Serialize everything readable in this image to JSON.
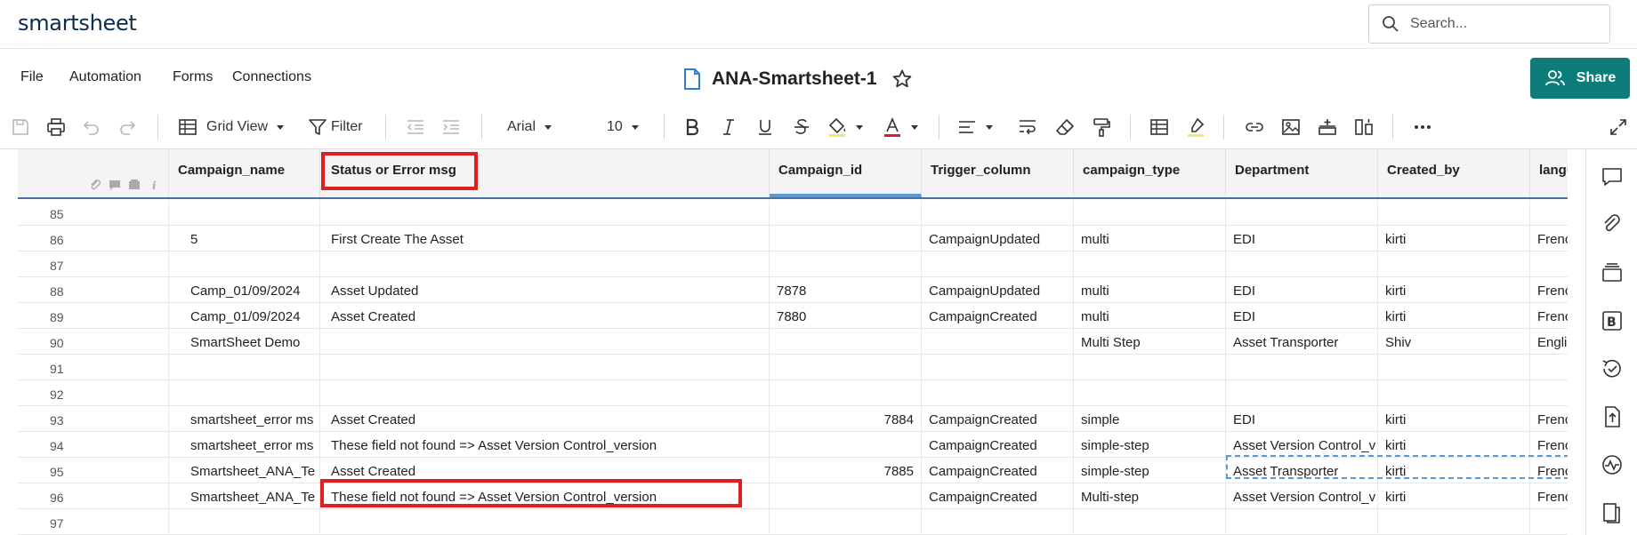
{
  "app": {
    "logo": "smartsheet"
  },
  "search": {
    "placeholder": "Search..."
  },
  "menu": {
    "file": "File",
    "automation": "Automation",
    "forms": "Forms",
    "connections": "Connections"
  },
  "document": {
    "title": "ANA-Smartsheet-1"
  },
  "share": {
    "label": "Share"
  },
  "toolbar": {
    "view": "Grid View",
    "filter": "Filter",
    "font": "Arial",
    "font_size": "10"
  },
  "columns": [
    "Campaign_name",
    "Status or Error msg",
    "Campaign_id",
    "Trigger_column",
    "campaign_type",
    "Department",
    "Created_by",
    "langua"
  ],
  "rows": [
    {
      "n": "85",
      "cells": [
        "",
        "",
        "",
        "",
        "",
        "",
        "",
        ""
      ]
    },
    {
      "n": "86",
      "cells": [
        "5",
        "First Create The Asset",
        "",
        "CampaignUpdated",
        "multi",
        "EDI",
        "kirti",
        "Frenc"
      ]
    },
    {
      "n": "87",
      "cells": [
        "",
        "",
        "",
        "",
        "",
        "",
        "",
        ""
      ]
    },
    {
      "n": "88",
      "cells": [
        "Camp_01/09/2024",
        "Asset Updated",
        "7878",
        "CampaignUpdated",
        "multi",
        "EDI",
        "kirti",
        "Frenc"
      ]
    },
    {
      "n": "89",
      "cells": [
        "Camp_01/09/2024",
        "Asset Created",
        "7880",
        "CampaignCreated",
        "multi",
        "EDI",
        "kirti",
        "Frenc"
      ]
    },
    {
      "n": "90",
      "cells": [
        "SmartSheet Demo",
        "",
        "",
        "",
        "Multi Step",
        "Asset Transporter",
        "Shiv",
        "Engli"
      ]
    },
    {
      "n": "91",
      "cells": [
        "",
        "",
        "",
        "",
        "",
        "",
        "",
        ""
      ]
    },
    {
      "n": "92",
      "cells": [
        "",
        "",
        "",
        "",
        "",
        "",
        "",
        ""
      ]
    },
    {
      "n": "93",
      "cells": [
        "smartsheet_error ms",
        "Asset Created",
        "7884",
        "CampaignCreated",
        "simple",
        "EDI",
        "kirti",
        "Frenc"
      ]
    },
    {
      "n": "94",
      "cells": [
        "smartsheet_error ms",
        "These field not found => Asset Version Control_version",
        "",
        "CampaignCreated",
        "simple-step",
        "Asset Version Control_v",
        "kirti",
        "Frenc"
      ]
    },
    {
      "n": "95",
      "cells": [
        "Smartsheet_ANA_Te",
        "Asset Created",
        "7885",
        "CampaignCreated",
        "simple-step",
        "Asset Transporter",
        "kirti",
        "Frenc"
      ]
    },
    {
      "n": "96",
      "cells": [
        "Smartsheet_ANA_Te",
        "These field not found => Asset Version Control_version",
        "",
        "CampaignCreated",
        "Multi-step",
        "Asset Version Control_v",
        "kirti",
        "Frenc"
      ]
    },
    {
      "n": "97",
      "cells": [
        "",
        "",
        "",
        "",
        "",
        "",
        "",
        ""
      ]
    }
  ],
  "colors": {
    "accent": "#0f7c7c",
    "highlight": "#e02020",
    "selection": "#5b9bd5"
  }
}
